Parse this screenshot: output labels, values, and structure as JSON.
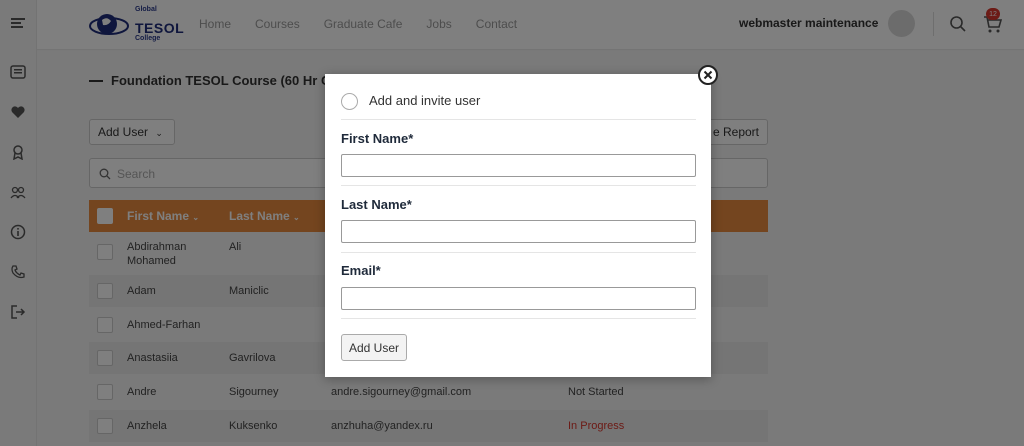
{
  "logo": {
    "small_top": "Global",
    "big": "TESOL",
    "small_bottom": "College"
  },
  "nav": [
    "Home",
    "Courses",
    "Graduate Cafe",
    "Jobs",
    "Contact"
  ],
  "user": {
    "name": "webmaster maintenance"
  },
  "cart": {
    "badge": "12"
  },
  "course": {
    "title": "Foundation TESOL Course (60 Hr C"
  },
  "toolbar": {
    "add_user_label": "Add User",
    "report_label": "e Report"
  },
  "search": {
    "placeholder": "Search"
  },
  "table": {
    "headers": {
      "first_name": "First Name",
      "last_name": "Last Name"
    },
    "rows": [
      {
        "first": "Abdirahman Mohamed",
        "last": "Ali",
        "email": "",
        "status": ""
      },
      {
        "first": "Adam",
        "last": "Maniclic",
        "email": "",
        "status": ""
      },
      {
        "first": "Ahmed-Farhan",
        "last": "",
        "email": "",
        "status": ""
      },
      {
        "first": "Anastasiia",
        "last": "Gavrilova",
        "email": "",
        "status": ""
      },
      {
        "first": "Andre",
        "last": "Sigourney",
        "email": "andre.sigourney@gmail.com",
        "status": "Not Started"
      },
      {
        "first": "Anzhela",
        "last": "Kuksenko",
        "email": "anzhuha@yandex.ru",
        "status": "In Progress"
      }
    ]
  },
  "modal": {
    "heading": "Add and invite user",
    "first_name_label": "First Name*",
    "last_name_label": "Last Name*",
    "email_label": "Email*",
    "first_name_value": "",
    "last_name_value": "",
    "email_value": "",
    "submit_label": "Add User"
  },
  "colors": {
    "accent": "#e98a3e",
    "status_in_progress": "#d9362c",
    "badge": "#d9362c"
  }
}
